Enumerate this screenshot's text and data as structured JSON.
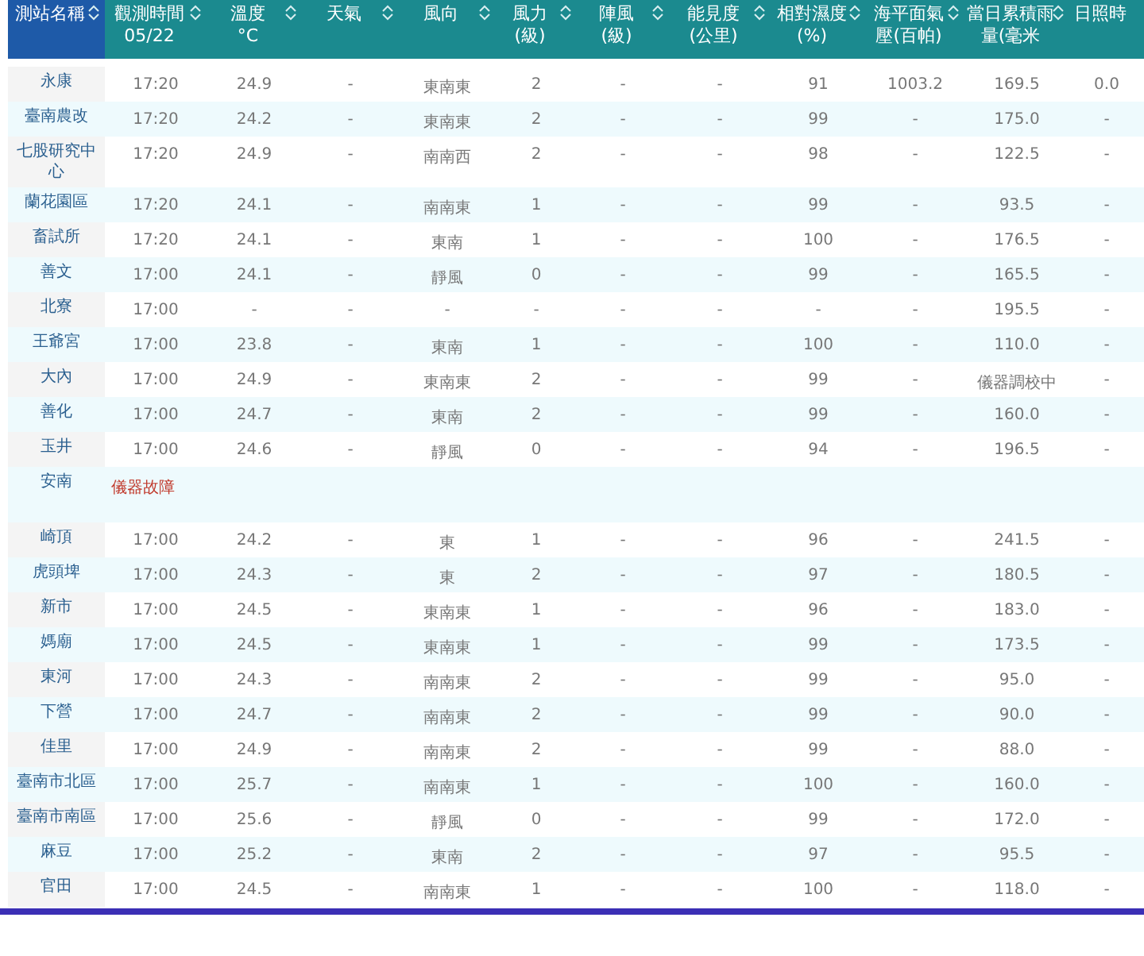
{
  "table": {
    "columns": [
      {
        "label": "測站名稱",
        "selected": true,
        "sortable": true
      },
      {
        "label": "觀測時間",
        "unit": "05/22",
        "selected": false,
        "sortable": true
      },
      {
        "label": "溫度",
        "unit": "°C",
        "selected": false,
        "sortable": true
      },
      {
        "label": "天氣",
        "selected": false,
        "sortable": true
      },
      {
        "label": "風向",
        "selected": false,
        "sortable": true
      },
      {
        "label": "風力",
        "unit": "(級)",
        "selected": false,
        "sortable": true
      },
      {
        "label": "陣風",
        "unit": "(級)",
        "selected": false,
        "sortable": true
      },
      {
        "label": "能見度",
        "unit": "(公里)",
        "selected": false,
        "sortable": true
      },
      {
        "label": "相對濕度",
        "unit": "(%)",
        "selected": false,
        "sortable": true
      },
      {
        "label": "海平面氣壓(百帕)",
        "selected": false,
        "sortable": true
      },
      {
        "label": "當日累積雨量(毫米",
        "selected": false,
        "sortable": true
      },
      {
        "label": "日照時",
        "selected": false,
        "sortable": false
      }
    ],
    "rows": [
      {
        "kind": "data",
        "station": "永康",
        "cells": [
          "17:20",
          "24.9",
          "-",
          "東南東",
          "2",
          "-",
          "-",
          "91",
          "1003.2",
          "169.5",
          "0.0"
        ]
      },
      {
        "kind": "data",
        "station": "臺南農改",
        "cells": [
          "17:20",
          "24.2",
          "-",
          "東南東",
          "2",
          "-",
          "-",
          "99",
          "-",
          "175.0",
          "-"
        ]
      },
      {
        "kind": "data",
        "station": "七股研究中心",
        "cells": [
          "17:20",
          "24.9",
          "-",
          "南南西",
          "2",
          "-",
          "-",
          "98",
          "-",
          "122.5",
          "-"
        ]
      },
      {
        "kind": "data",
        "station": "蘭花園區",
        "cells": [
          "17:20",
          "24.1",
          "-",
          "南南東",
          "1",
          "-",
          "-",
          "99",
          "-",
          "93.5",
          "-"
        ]
      },
      {
        "kind": "data",
        "station": "畜試所",
        "cells": [
          "17:20",
          "24.1",
          "-",
          "東南",
          "1",
          "-",
          "-",
          "100",
          "-",
          "176.5",
          "-"
        ]
      },
      {
        "kind": "data",
        "station": "善文",
        "cells": [
          "17:00",
          "24.1",
          "-",
          "靜風",
          "0",
          "-",
          "-",
          "99",
          "-",
          "165.5",
          "-"
        ]
      },
      {
        "kind": "data",
        "station": "北寮",
        "cells": [
          "17:00",
          "-",
          "-",
          "-",
          "-",
          "-",
          "-",
          "-",
          "-",
          "195.5",
          "-"
        ]
      },
      {
        "kind": "data",
        "station": "王爺宮",
        "cells": [
          "17:00",
          "23.8",
          "-",
          "東南",
          "1",
          "-",
          "-",
          "100",
          "-",
          "110.0",
          "-"
        ]
      },
      {
        "kind": "data",
        "station": "大內",
        "cells": [
          "17:00",
          "24.9",
          "-",
          "東南東",
          "2",
          "-",
          "-",
          "99",
          "-",
          "儀器調校中",
          "-"
        ]
      },
      {
        "kind": "data",
        "station": "善化",
        "cells": [
          "17:00",
          "24.7",
          "-",
          "東南",
          "2",
          "-",
          "-",
          "99",
          "-",
          "160.0",
          "-"
        ]
      },
      {
        "kind": "data",
        "station": "玉井",
        "cells": [
          "17:00",
          "24.6",
          "-",
          "靜風",
          "0",
          "-",
          "-",
          "94",
          "-",
          "196.5",
          "-"
        ]
      },
      {
        "kind": "fault",
        "station": "安南",
        "note": "儀器故障"
      },
      {
        "kind": "data",
        "station": "崎頂",
        "cells": [
          "17:00",
          "24.2",
          "-",
          "東",
          "1",
          "-",
          "-",
          "96",
          "-",
          "241.5",
          "-"
        ]
      },
      {
        "kind": "data",
        "station": "虎頭埤",
        "cells": [
          "17:00",
          "24.3",
          "-",
          "東",
          "2",
          "-",
          "-",
          "97",
          "-",
          "180.5",
          "-"
        ]
      },
      {
        "kind": "data",
        "station": "新市",
        "cells": [
          "17:00",
          "24.5",
          "-",
          "東南東",
          "1",
          "-",
          "-",
          "96",
          "-",
          "183.0",
          "-"
        ]
      },
      {
        "kind": "data",
        "station": "媽廟",
        "cells": [
          "17:00",
          "24.5",
          "-",
          "東南東",
          "1",
          "-",
          "-",
          "99",
          "-",
          "173.5",
          "-"
        ]
      },
      {
        "kind": "data",
        "station": "東河",
        "cells": [
          "17:00",
          "24.3",
          "-",
          "南南東",
          "2",
          "-",
          "-",
          "99",
          "-",
          "95.0",
          "-"
        ]
      },
      {
        "kind": "data",
        "station": "下營",
        "cells": [
          "17:00",
          "24.7",
          "-",
          "南南東",
          "2",
          "-",
          "-",
          "99",
          "-",
          "90.0",
          "-"
        ]
      },
      {
        "kind": "data",
        "station": "佳里",
        "cells": [
          "17:00",
          "24.9",
          "-",
          "南南東",
          "2",
          "-",
          "-",
          "99",
          "-",
          "88.0",
          "-"
        ]
      },
      {
        "kind": "data",
        "station": "臺南市北區",
        "cells": [
          "17:00",
          "25.7",
          "-",
          "南南東",
          "1",
          "-",
          "-",
          "100",
          "-",
          "160.0",
          "-"
        ]
      },
      {
        "kind": "data",
        "station": "臺南市南區",
        "cells": [
          "17:00",
          "25.6",
          "-",
          "靜風",
          "0",
          "-",
          "-",
          "99",
          "-",
          "172.0",
          "-"
        ]
      },
      {
        "kind": "data",
        "station": "麻豆",
        "cells": [
          "17:00",
          "25.2",
          "-",
          "東南",
          "2",
          "-",
          "-",
          "97",
          "-",
          "95.5",
          "-"
        ]
      },
      {
        "kind": "data",
        "station": "官田",
        "cells": [
          "17:00",
          "24.5",
          "-",
          "南南東",
          "1",
          "-",
          "-",
          "100",
          "-",
          "118.0",
          "-"
        ]
      }
    ]
  }
}
